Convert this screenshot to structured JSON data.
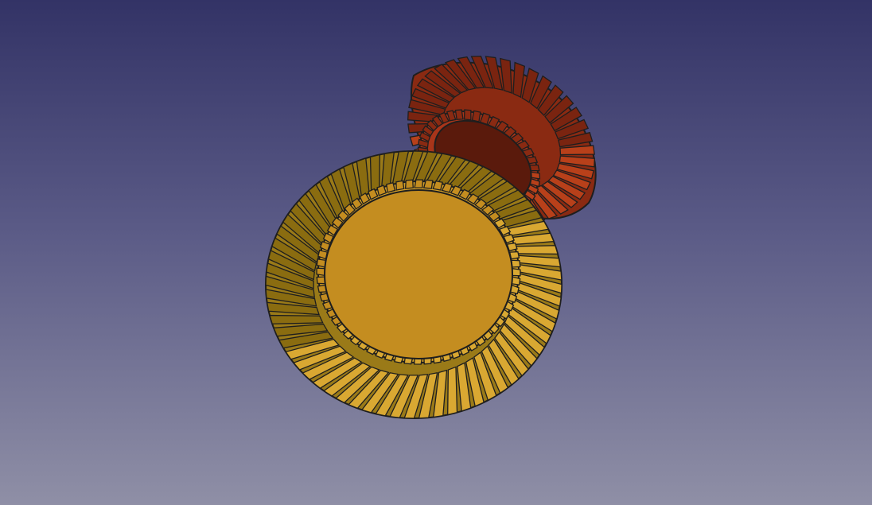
{
  "scene": {
    "objects": [
      {
        "name": "large-bevel-gear",
        "color": "#c48d20",
        "teeth_color": "#d9a832",
        "teeth": 64
      },
      {
        "name": "pinion-bevel-gear",
        "color": "#6e1a0e",
        "teeth_color": "#b8401a",
        "teeth": 40
      }
    ],
    "background_top": "#333366",
    "background_bottom": "#8f8fa6"
  }
}
